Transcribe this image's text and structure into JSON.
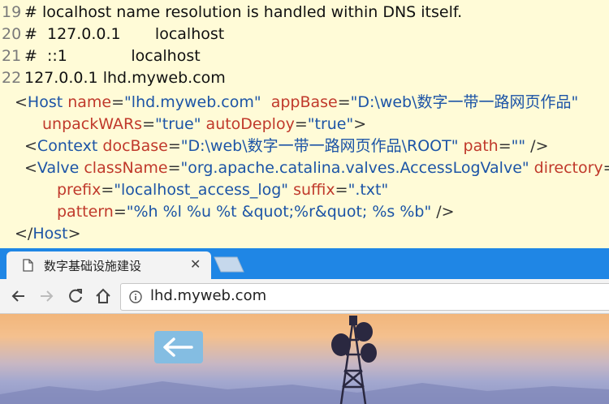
{
  "hosts_file": {
    "lines": [
      {
        "num": "19",
        "text": "# localhost name resolution is handled within DNS itself."
      },
      {
        "num": "20",
        "text": "#  127.0.0.1       localhost"
      },
      {
        "num": "21",
        "text": "#  ::1             localhost"
      },
      {
        "num": "22",
        "text": "127.0.0.1 lhd.myweb.com"
      }
    ]
  },
  "server_xml": {
    "host_open": {
      "lt": "<",
      "tag": "Host",
      "attr_name": "name",
      "eq": "=",
      "val_name": "\"lhd.myweb.com\"",
      "attr_appbase": "appBase",
      "val_appbase": "\"D:\\web\\数字一带一路网页作品\""
    },
    "host_cont": {
      "attr_unpack": "unpackWARs",
      "val_unpack": "\"true\"",
      "attr_autodeploy": "autoDeploy",
      "val_autodeploy": "\"true\"",
      "gt": ">"
    },
    "context": {
      "lt": "<",
      "tag": "Context",
      "attr_docbase": "docBase",
      "val_docbase": "\"D:\\web\\数字一带一路网页作品\\ROOT\"",
      "attr_path": "path",
      "val_path": "\"\"",
      "close": "/>"
    },
    "valve": {
      "lt": "<",
      "tag": "Valve",
      "attr_classname": "className",
      "val_classname": "\"org.apache.catalina.valves.AccessLogValve\"",
      "attr_directory": "directory",
      "val_directory": "\""
    },
    "valve_prefix": {
      "attr_prefix": "prefix",
      "val_prefix": "\"localhost_access_log\"",
      "attr_suffix": "suffix",
      "val_suffix": "\".txt\""
    },
    "valve_pattern": {
      "attr_pattern": "pattern",
      "val_pattern": "\"%h %l %u %t &quot;%r&quot; %s %b\"",
      "close": "/>"
    },
    "host_close": {
      "lt": "</",
      "tag": "Host",
      "gt": ">"
    }
  },
  "browser": {
    "tab": {
      "title": "数字基础设施建设",
      "close_glyph": "✕",
      "icon": "page-icon"
    },
    "nav": {
      "back_icon": "arrow-left-icon",
      "forward_icon": "arrow-right-icon",
      "reload_icon": "reload-icon",
      "home_icon": "home-icon"
    },
    "address_bar": {
      "url": "lhd.myweb.com",
      "icon": "info-icon"
    },
    "colors": {
      "tabstrip": "#1f86e5",
      "toolbar": "#f3f3f3",
      "back_button": "#84bde2"
    }
  },
  "page": {
    "back_button_icon": "arrow-left-icon"
  }
}
